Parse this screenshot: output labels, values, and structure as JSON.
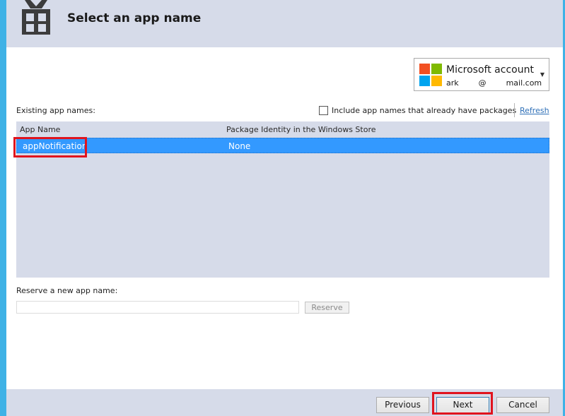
{
  "header": {
    "title": "Select an app name",
    "icon": "store-bag-icon"
  },
  "account": {
    "title": "Microsoft account",
    "email": "ark        @        mail.com",
    "logo": "microsoft-logo-icon",
    "logo_colors": [
      "#f25022",
      "#7fba00",
      "#00a4ef",
      "#ffb900"
    ]
  },
  "existing": {
    "label": "Existing app names:",
    "include_label": "Include app names that already have packages",
    "include_checked": false,
    "refresh": "Refresh"
  },
  "table": {
    "columns": [
      "App Name",
      "Package Identity in the Windows Store"
    ],
    "rows": [
      {
        "app_name": "appNotification",
        "identity": "None",
        "selected": true
      }
    ]
  },
  "reserve": {
    "label": "Reserve a new app name:",
    "value": "",
    "button": "Reserve"
  },
  "footer": {
    "previous": "Previous",
    "next": "Next",
    "cancel": "Cancel"
  },
  "colors": {
    "accent_frame": "#3fb2e6",
    "header_bg": "#d6dbe9",
    "selection": "#3399ff",
    "highlight": "#e0141e"
  }
}
